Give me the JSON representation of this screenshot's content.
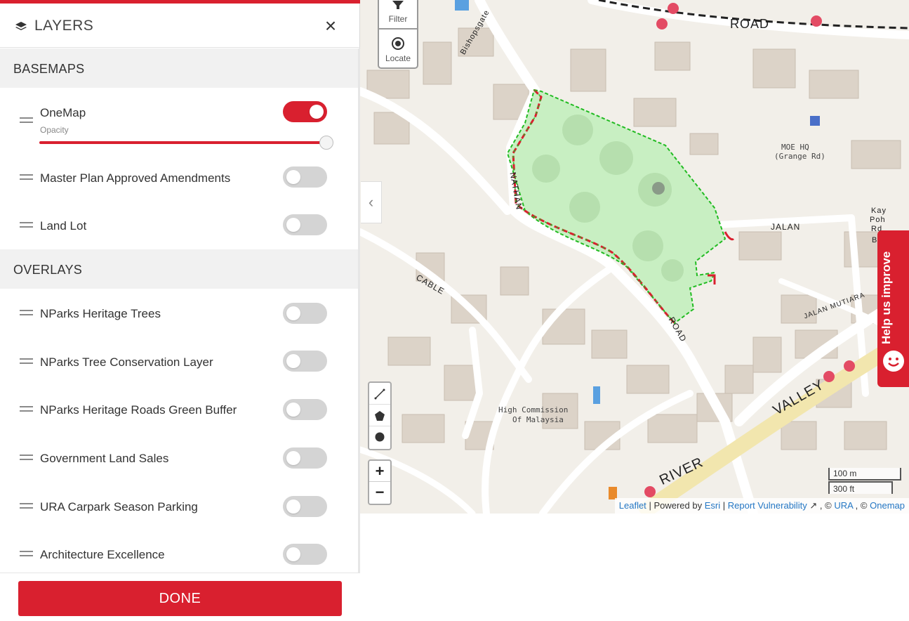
{
  "panel": {
    "title": "LAYERS",
    "close_icon": "×",
    "basemaps_heading": "BASEMAPS",
    "overlays_heading": "OVERLAYS",
    "basemaps": [
      {
        "label": "OneMap",
        "enabled": true,
        "opacity_label": "Opacity",
        "opacity": 1.0
      },
      {
        "label": "Master Plan Approved Amendments",
        "enabled": false
      },
      {
        "label": "Land Lot",
        "enabled": false
      }
    ],
    "overlays": [
      {
        "label": "NParks Heritage Trees",
        "enabled": false
      },
      {
        "label": "NParks Tree Conservation Layer",
        "enabled": false
      },
      {
        "label": "NParks Heritage Roads Green Buffer",
        "enabled": false
      },
      {
        "label": "Government Land Sales",
        "enabled": false
      },
      {
        "label": "URA Carpark Season Parking",
        "enabled": false
      },
      {
        "label": "Architecture Excellence",
        "enabled": false
      }
    ],
    "done_label": "DONE"
  },
  "map": {
    "controls": {
      "filter_label": "Filter",
      "locate_label": "Locate",
      "zoom_in": "+",
      "zoom_out": "−",
      "collapse_icon": "‹"
    },
    "scale": {
      "metric": "100 m",
      "imperial": "300 ft"
    },
    "attribution": {
      "leaflet": "Leaflet",
      "powered_by": "Powered by",
      "esri": "Esri",
      "report": "Report Vulnerability",
      "copy1": "©",
      "ura": "URA",
      "copy2": "©",
      "onemap": "Onemap"
    },
    "feedback_label": "Help us improve",
    "labels": {
      "moe": "MOE HQ",
      "moe_sub": "(Grange Rd)",
      "commission": "High Commission",
      "commission_sub": "Of Malaysia",
      "jalan": "JALAN",
      "jalan_mutiara": "JALAN MUTIARA",
      "road_top": "ROAD",
      "river": "RIVER",
      "valley": "VALLEY",
      "cable": "CABLE",
      "nathan": "NATHAN",
      "bishopsgate": "Bishopsgate",
      "road1": "ROAD",
      "kay": "Kay",
      "poh": "Poh",
      "rd": "Rd",
      "bap": "Bap"
    },
    "colors": {
      "accent": "#d9202f",
      "park_fill": "#c8efc2",
      "boundary": "#22bb22"
    }
  }
}
